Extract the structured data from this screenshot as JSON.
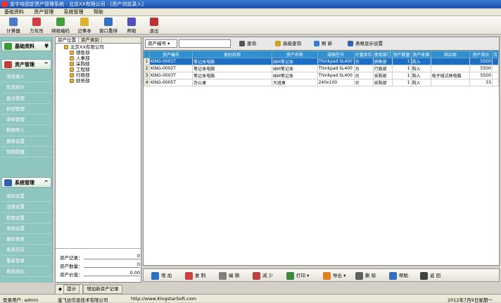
{
  "window": {
    "title": "金宇培固定资产管理系统 - 北京XX有限公司 - [资产浏览录入]"
  },
  "menu": [
    "基础资料",
    "资产管理",
    "系统管理",
    "帮助"
  ],
  "toolbar": [
    {
      "label": "计算器",
      "icon": "calculator-icon",
      "color": "#4a7ac8"
    },
    {
      "label": "万年历",
      "icon": "calendar-icon",
      "color": "#d04040"
    },
    {
      "label": "邮政编码",
      "icon": "postcode-icon",
      "color": "#40a040"
    },
    {
      "label": "记事本",
      "icon": "notepad-icon",
      "color": "#e0b030"
    },
    {
      "label": "窗口重排",
      "icon": "window-arrange-icon",
      "color": "#3070c0"
    },
    {
      "label": "帮助",
      "icon": "help-icon",
      "color": "#5050c0"
    },
    {
      "label": "退出",
      "icon": "exit-icon",
      "color": "#c03030"
    }
  ],
  "sidebar": {
    "basic": {
      "label": "基础资料"
    },
    "asset": {
      "label": "资产管理",
      "items": [
        "浏览录入",
        "信息统计",
        "盘点管理",
        "折旧管理",
        "审核管理",
        "数据导入",
        "报表设置",
        "到期提醒"
      ]
    },
    "system": {
      "label": "系统管理",
      "items": [
        "密码设置",
        "注册设置",
        "权限设置",
        "系统设置",
        "备份恢复",
        "系统日志",
        "重新登录",
        "系统退出"
      ]
    }
  },
  "tree": {
    "tabs": [
      "资产位置",
      "资产类别"
    ],
    "root": "北京XX有限公司",
    "children": [
      "销售部",
      "人事部",
      "采购部",
      "工程部",
      "行政部",
      "财务部"
    ]
  },
  "summary": {
    "records_label": "资产记录：",
    "records_value": "0",
    "qty_label": "资产数量：",
    "qty_value": "0",
    "value_label": "资产价值：",
    "value_value": "0.00"
  },
  "bottom_tabs": [
    "提示",
    "增加新资产记录"
  ],
  "search": {
    "field": "资产编号",
    "buttons": [
      {
        "label": "查询",
        "icon": "binoculars-icon",
        "color": "#555"
      },
      {
        "label": "高级查询",
        "icon": "advanced-search-icon",
        "color": "#d0a020"
      },
      {
        "label": "刷 新",
        "icon": "refresh-icon",
        "color": "#3080d0"
      },
      {
        "label": "表格显示设置",
        "icon": "table-settings-icon",
        "color": "#3060b0"
      }
    ]
  },
  "table": {
    "columns": [
      "资产编号",
      "类别名称",
      "资产名称",
      "规格型号",
      "计量单位",
      "使用部门",
      "资产数量",
      "资产来源",
      "供应商",
      "资产单价",
      "合"
    ],
    "rows": [
      {
        "n": "1",
        "cells": [
          "KING-0001T",
          "笔记本电脑",
          "IBM笔记本",
          "Thinkpad SL400",
          "台",
          "销售部",
          "1",
          "购入",
          "",
          "5500",
          ""
        ]
      },
      {
        "n": "2",
        "cells": [
          "KING-0002T",
          "笔记本电脑",
          "IBM笔记本",
          "Thinkpad SL400",
          "台",
          "行政部",
          "1",
          "购入",
          "",
          "5500",
          ""
        ]
      },
      {
        "n": "3",
        "cells": [
          "KING-0003T",
          "笔记本电脑",
          "IBM笔记本",
          "Thinkpad SL400",
          "台",
          "采购部",
          "1",
          "购入",
          "电子城试林电脑",
          "5500",
          ""
        ]
      },
      {
        "n": "4",
        "cells": [
          "KING-0005T",
          "办公桌",
          "大班桌",
          "240x100",
          "台",
          "采购部",
          "1",
          "购入",
          "",
          "33",
          ""
        ]
      }
    ]
  },
  "actions": [
    {
      "label": "增 加",
      "icon": "add-icon",
      "color": "#3070c0"
    },
    {
      "label": "复 制",
      "icon": "copy-icon",
      "color": "#d04040"
    },
    {
      "label": "编 辑",
      "icon": "edit-icon",
      "color": "#808080"
    },
    {
      "label": "减 少",
      "icon": "reduce-icon",
      "color": "#c04040"
    },
    {
      "label": "打印",
      "icon": "print-icon",
      "color": "#3a8a3a"
    },
    {
      "label": "导出",
      "icon": "export-icon",
      "color": "#e08020"
    },
    {
      "label": "删 除",
      "icon": "delete-icon",
      "color": "#606060"
    },
    {
      "label": "帮助",
      "icon": "help-icon",
      "color": "#3070c0"
    },
    {
      "label": "返 回",
      "icon": "back-icon",
      "color": "#404040"
    }
  ],
  "status": {
    "user": "登录用户: admin",
    "company": "金飞达信息技术有限公司",
    "url": "http://www.KingstarSoft.com",
    "date": "2012年7月9日星期一"
  }
}
